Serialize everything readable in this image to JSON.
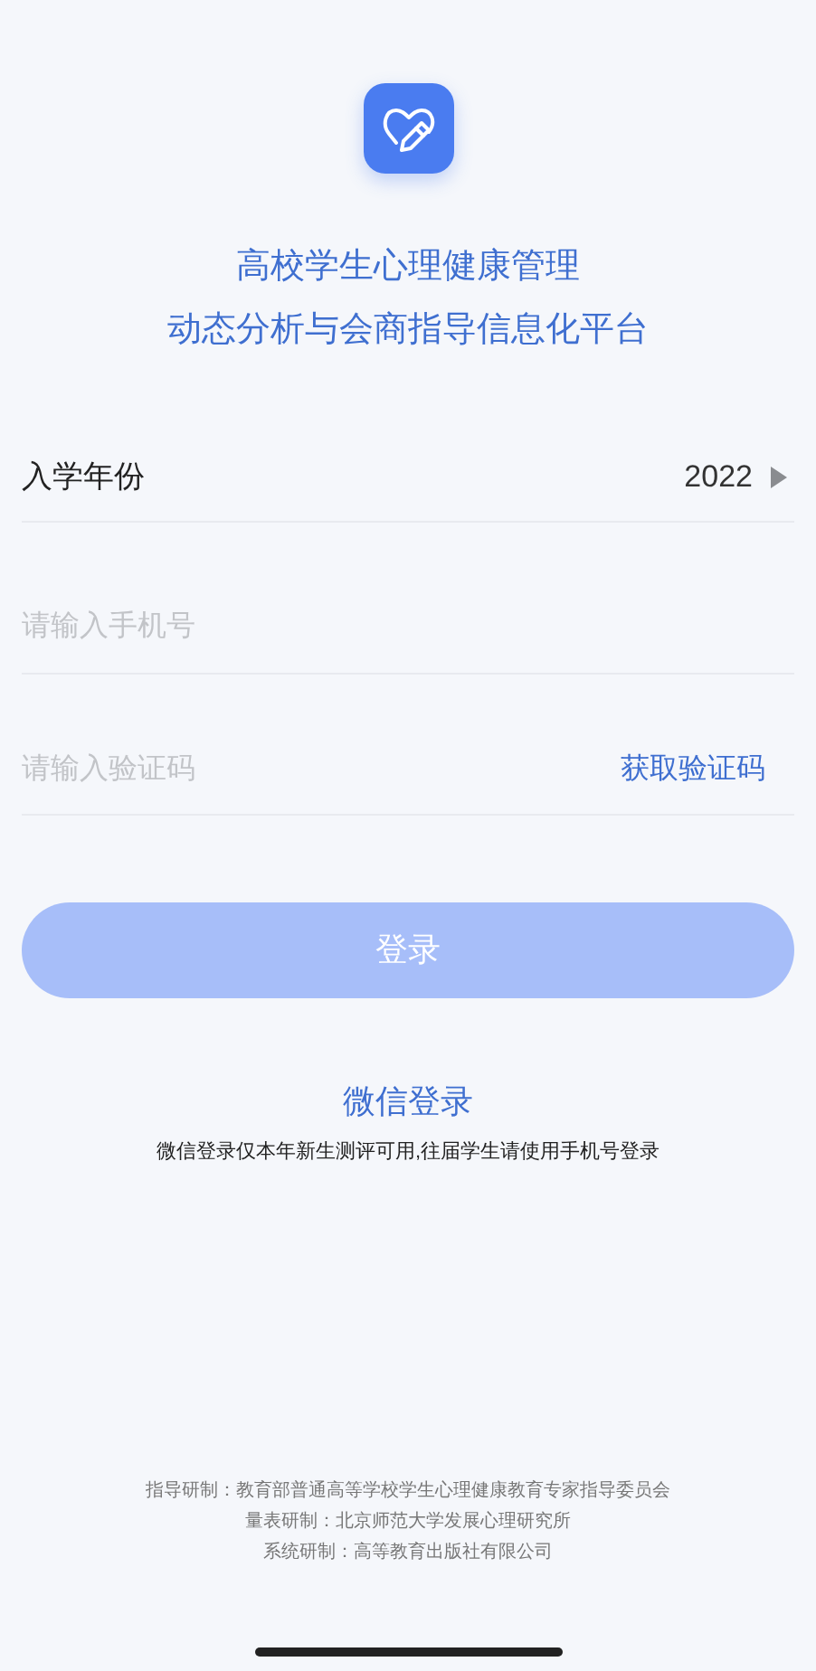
{
  "title_lines": [
    "高校学生心理健康管理",
    "动态分析与会商指导信息化平台"
  ],
  "year": {
    "label": "入学年份",
    "value": "2022"
  },
  "phone": {
    "placeholder": "请输入手机号"
  },
  "code": {
    "placeholder": "请输入验证码",
    "action": "获取验证码"
  },
  "login_button": {
    "label": "登录",
    "disabled": true
  },
  "wechat": {
    "label": "微信登录",
    "note": "微信登录仅本年新生测评可用,往届学生请使用手机号登录"
  },
  "credits": [
    "指导研制：教育部普通高等学校学生心理健康教育专家指导委员会",
    "量表研制：北京师范大学发展心理研究所",
    "系统研制：高等教育出版社有限公司"
  ]
}
